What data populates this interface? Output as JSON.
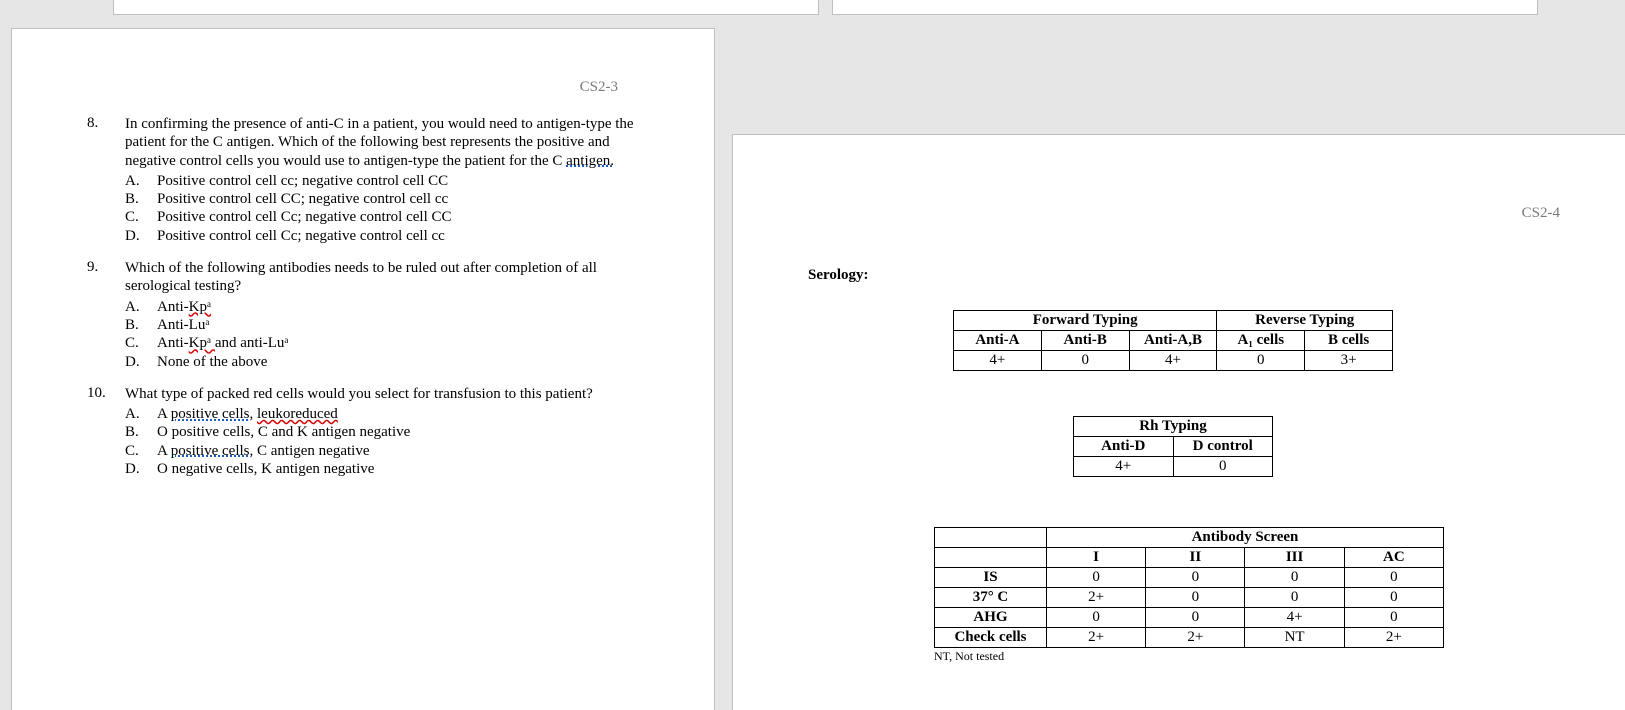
{
  "pages": {
    "left": {
      "header": "CS2-3"
    },
    "right": {
      "header": "CS2-4"
    }
  },
  "questions": [
    {
      "num": "8.",
      "text_pre": "In confirming the presence of anti-C in a patient, you would need to antigen-type the patient for the C antigen. Which of the following best represents the positive and negative control cells you would use to antigen-type the patient for the C ",
      "text_gram": "antigen.",
      "opts": [
        {
          "l": "A.",
          "t": "Positive control cell cc; negative control cell CC"
        },
        {
          "l": "B.",
          "t": "Positive control cell CC; negative control cell cc"
        },
        {
          "l": "C.",
          "t": "Positive control cell Cc; negative control cell CC"
        },
        {
          "l": "D.",
          "t": "Positive control cell Cc; negative control cell cc"
        }
      ]
    },
    {
      "num": "9.",
      "text": "Which of the following antibodies needs to be ruled out after completion of all serological testing?",
      "opts": [
        {
          "l": "A.",
          "pre": "Anti-",
          "kp": "Kpᵃ"
        },
        {
          "l": "B.",
          "pre": "Anti-",
          "lu": "Luᵃ"
        },
        {
          "l": "C.",
          "pre": "Anti-",
          "kp": "Kpᵃ ",
          "mid": "and anti-",
          "lu": "Luᵃ"
        },
        {
          "l": "D.",
          "t": "None of the above"
        }
      ]
    },
    {
      "num": "10.",
      "text": "What type of packed red cells would you select for transfusion to this patient?",
      "opts": [
        {
          "l": "A.",
          "pre": "A ",
          "g1": "positive cells",
          "mid": ", ",
          "sp": "leukoreduced"
        },
        {
          "l": "B.",
          "t": "O positive cells, C and K antigen negative"
        },
        {
          "l": "C.",
          "pre": "A ",
          "g1": "positive cells",
          "mid": ", C antigen negative"
        },
        {
          "l": "D.",
          "t": "O negative cells, K antigen negative"
        }
      ]
    }
  ],
  "serology": {
    "label": "Serology:",
    "forward_reverse": {
      "group1": "Forward Typing",
      "group2": "Reverse Typing",
      "cols": [
        "Anti-A",
        "Anti-B",
        "Anti-A,B",
        "A₁ cells",
        "B cells"
      ],
      "row": [
        "4+",
        "0",
        "4+",
        "0",
        "3+"
      ]
    },
    "rh": {
      "title": "Rh Typing",
      "cols": [
        "Anti-D",
        "D control"
      ],
      "row": [
        "4+",
        "0"
      ]
    },
    "screen": {
      "title": "Antibody Screen",
      "cols": [
        "",
        "I",
        "II",
        "III",
        "AC"
      ],
      "rows": [
        [
          "IS",
          "0",
          "0",
          "0",
          "0"
        ],
        [
          "37° C",
          "2+",
          "0",
          "0",
          "0"
        ],
        [
          "AHG",
          "0",
          "0",
          "4+",
          "0"
        ],
        [
          "Check cells",
          "2+",
          "2+",
          "NT",
          "2+"
        ]
      ],
      "footnote": "NT, Not tested"
    }
  }
}
